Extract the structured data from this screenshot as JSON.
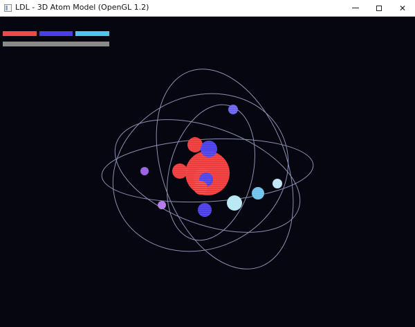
{
  "window": {
    "title": "LDL - 3D Atom Model (OpenGL 1.2)",
    "controls": [
      "minimize",
      "maximize",
      "close"
    ]
  },
  "hud": {
    "bars": [
      {
        "name": "red-indicator",
        "color": "#ee4a4a"
      },
      {
        "name": "blue-indicator",
        "color": "#4a3ee8"
      },
      {
        "name": "cyan-indicator",
        "color": "#4ec5ee"
      },
      {
        "name": "gray-indicator",
        "color": "#8a8a8a"
      }
    ]
  },
  "scene": {
    "background": "#05060f",
    "orbit_color": "#8c91b4",
    "nucleus": {
      "proton_color": "#ee3b3b",
      "neutron_color": "#4a3ee8"
    },
    "electrons": [
      {
        "color": "#6a63f0"
      },
      {
        "color": "#9a5fe0"
      },
      {
        "color": "#b477e8"
      },
      {
        "color": "#4a3ee8"
      },
      {
        "color": "#b8e8f4"
      },
      {
        "color": "#6fc3ec"
      },
      {
        "color": "#bfe4f6"
      }
    ]
  }
}
